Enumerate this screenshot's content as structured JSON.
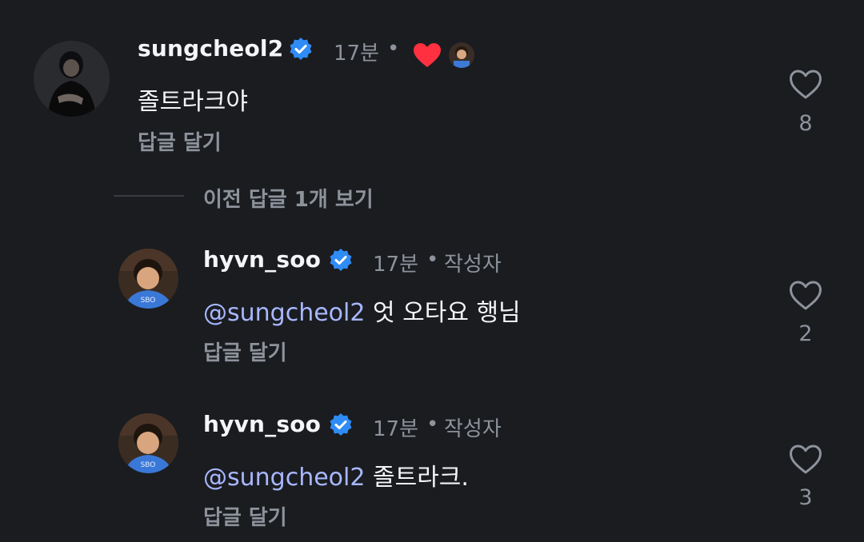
{
  "comments": [
    {
      "username": "sungcheol2",
      "time": "17분",
      "separator": "•",
      "text": "졸트라크야",
      "reply_label": "답글 달기",
      "likes": "8",
      "icons": [
        "verified-icon",
        "heart-filled-icon",
        "liker-avatar",
        "heart-outline-icon"
      ]
    },
    {
      "username": "hyvn_soo",
      "time": "17분",
      "separator": "•",
      "author_badge": "작성자",
      "mention": "@sungcheol2",
      "text": " 엇 오타요 행님",
      "reply_label": "답글 달기",
      "likes": "2"
    },
    {
      "username": "hyvn_soo",
      "time": "17분",
      "separator": "•",
      "author_badge": "작성자",
      "mention": "@sungcheol2",
      "text": " 졸트라크.",
      "reply_label": "답글 달기",
      "likes": "3"
    }
  ],
  "view_previous_replies": "이전 답글 1개 보기",
  "colors": {
    "background": "#1a1c20",
    "text": "#f3f5f7",
    "muted": "#8d929b",
    "mention": "#a8b7ff",
    "verified": "#2f8cf6",
    "heart": "#ff3040"
  }
}
